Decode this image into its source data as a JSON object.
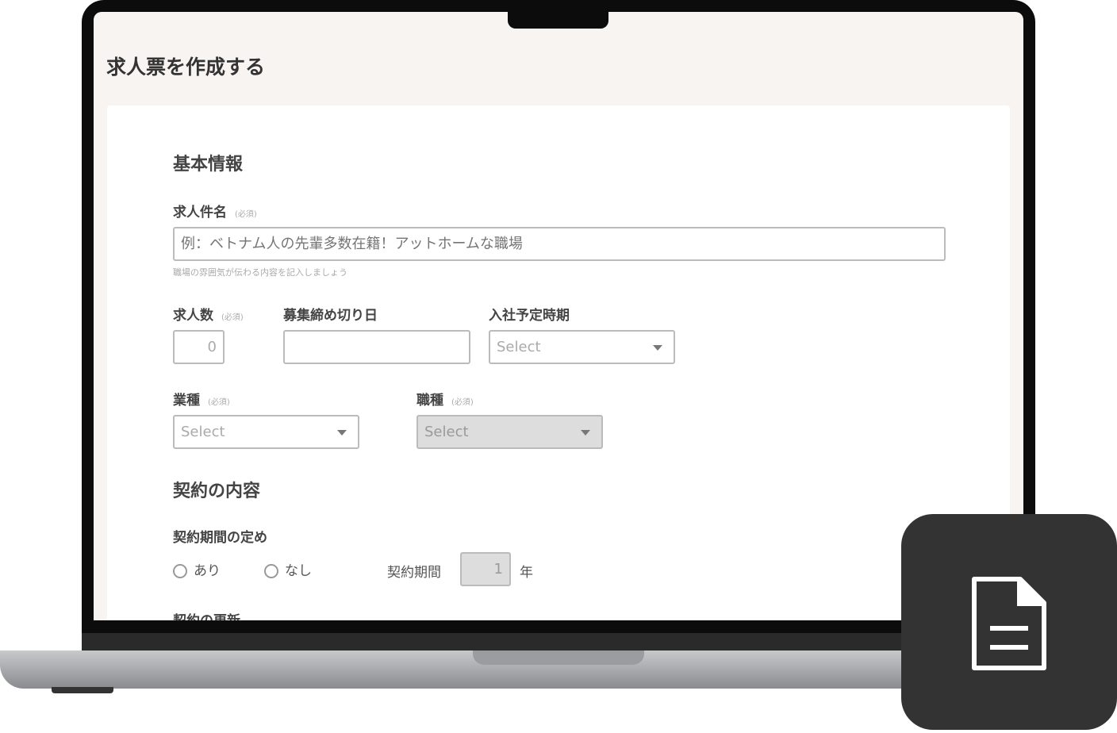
{
  "page": {
    "title": "求人票を作成する"
  },
  "basic": {
    "heading": "基本情報",
    "job_title": {
      "label": "求人件名",
      "required": "(必須)",
      "placeholder": "例：ベトナム人の先輩多数在籍！アットホームな職場",
      "hint": "職場の雰囲気が伝わる内容を記入しましょう"
    },
    "openings": {
      "label": "求人数",
      "required": "(必須)",
      "value": "0"
    },
    "deadline": {
      "label": "募集締め切り日",
      "value": ""
    },
    "start": {
      "label": "入社予定時期",
      "value": "Select"
    },
    "industry": {
      "label": "業種",
      "required": "(必須)",
      "value": "Select"
    },
    "occupation": {
      "label": "職種",
      "required": "(必須)",
      "value": "Select"
    }
  },
  "contract": {
    "heading": "契約の内容",
    "period_def": {
      "label": "契約期間の定め",
      "options": [
        "あり",
        "なし"
      ],
      "period_label": "契約期間",
      "period_value": "1",
      "unit": "年"
    },
    "renewal": {
      "label": "契約の更新"
    }
  },
  "icons": {
    "badge": "document-icon"
  }
}
